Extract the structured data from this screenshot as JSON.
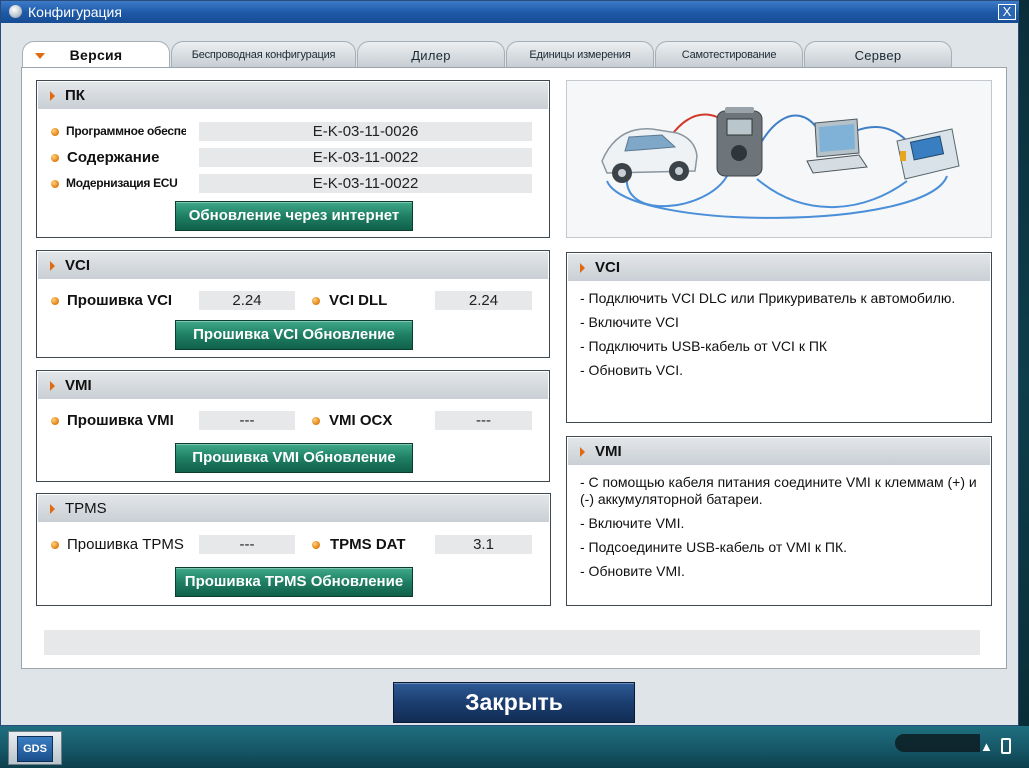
{
  "window": {
    "title": "Конфигурация",
    "close_glyph": "X"
  },
  "tabs": [
    {
      "label": "Версия",
      "active": true
    },
    {
      "label": "Беспроводная конфигурация"
    },
    {
      "label": "Дилер"
    },
    {
      "label": "Единицы измерения"
    },
    {
      "label": "Самотестирование"
    },
    {
      "label": "Сервер"
    }
  ],
  "pc": {
    "title": "ПК",
    "rows": [
      {
        "label": "Программное обеспечени",
        "value": "E-K-03-11-0026"
      },
      {
        "label": "Содержание",
        "value": "E-K-03-11-0022"
      },
      {
        "label": "Модернизация ECU",
        "value": "E-K-03-11-0022"
      }
    ],
    "button": "Обновление через интернет"
  },
  "vci": {
    "title": "VCI",
    "firmware_label": "Прошивка VCI",
    "firmware_value": "2.24",
    "dll_label": "VCI DLL",
    "dll_value": "2.24",
    "button": "Прошивка VCI Обновление"
  },
  "vmi": {
    "title": "VMI",
    "firmware_label": "Прошивка VMI",
    "firmware_value": "---",
    "ocx_label": "VMI OCX",
    "ocx_value": "---",
    "button": "Прошивка VMI Обновление"
  },
  "tpms": {
    "title": "TPMS",
    "firmware_label": "Прошивка TPMS",
    "firmware_value": "---",
    "dat_label": "TPMS DAT",
    "dat_value": "3.1",
    "button": "Прошивка TPMS Обновление"
  },
  "vci_info": {
    "title": "VCI",
    "items": [
      "- Подключить VCI DLC или Прикуриватель к автомобилю.",
      "- Включите VCI",
      "- Подключить USB-кабель от VCI к ПК",
      "- Обновить VCI."
    ]
  },
  "vmi_info": {
    "title": "VMI",
    "items": [
      "- С помощью кабеля питания соедините VMI к клеммам (+) и (-) аккумуляторной батареи.",
      "- Включите VMI.",
      "- Подсоедините USB-кабель от VMI к ПК.",
      "- Обновите VMI."
    ]
  },
  "footer": {
    "close_button": "Закрыть"
  },
  "taskbar": {
    "gds_label": "GDS",
    "tray_text": "▲"
  },
  "colors": {
    "accent": "#e06a12",
    "title_bar": "#1e5aa8",
    "green_button": "#1f7f63",
    "close_button": "#1b3e70"
  }
}
